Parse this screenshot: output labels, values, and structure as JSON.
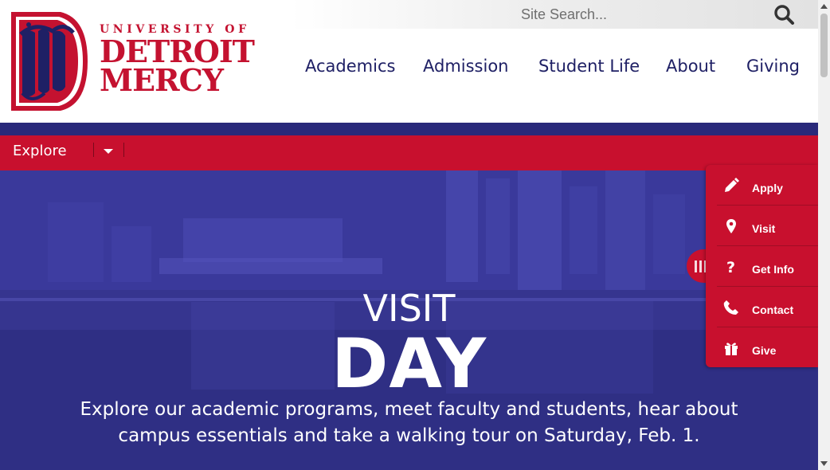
{
  "logo": {
    "line1": "UNIVERSITY OF",
    "line2": "DETROIT",
    "line3": "MERCY",
    "colors": {
      "red": "#c41230",
      "navy": "#1f2065"
    }
  },
  "search": {
    "placeholder": "Site Search...",
    "icon": "search-icon"
  },
  "nav": {
    "items": [
      {
        "label": "Academics"
      },
      {
        "label": "Admission"
      },
      {
        "label": "Student Life"
      },
      {
        "label": "About"
      },
      {
        "label": "Giving"
      }
    ]
  },
  "explore": {
    "label": "Explore",
    "icon": "caret-down-icon"
  },
  "hero": {
    "title_small": "VISIT",
    "title_large": "DAY",
    "description": "Explore our academic programs, meet faculty and students, hear about campus essentials and take a walking tour on Saturday, Feb. 1."
  },
  "quick_links": {
    "items": [
      {
        "label": "Apply",
        "icon": "pencil-icon"
      },
      {
        "label": "Visit",
        "icon": "map-marker-icon"
      },
      {
        "label": "Get Info",
        "icon": "question-icon"
      },
      {
        "label": "Contact",
        "icon": "phone-icon"
      },
      {
        "label": "Give",
        "icon": "gift-icon"
      }
    ],
    "tab_icon": "menu-lines-icon"
  },
  "colors": {
    "brand_red": "#c8102e",
    "brand_navy": "#29297a",
    "nav_text": "#1f2065"
  }
}
